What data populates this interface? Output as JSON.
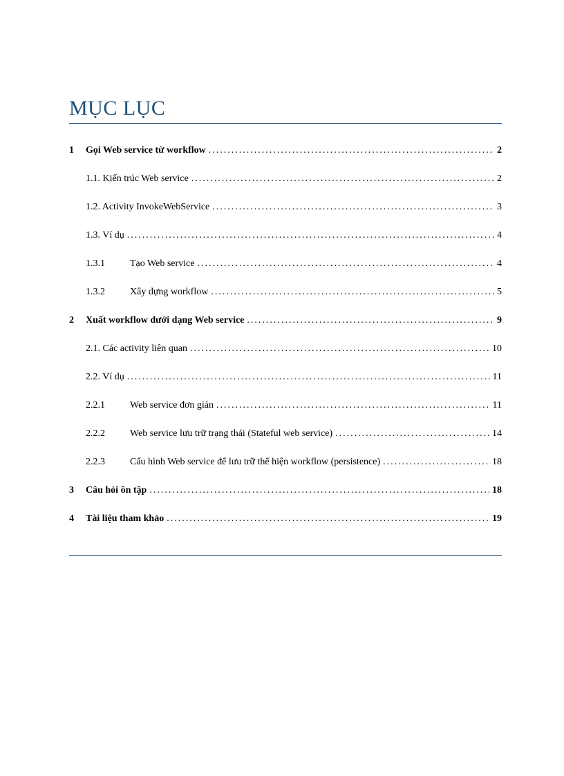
{
  "title": "MỤC LỤC",
  "entries": [
    {
      "level": 1,
      "num": "1",
      "label": "Gọi Web service từ workflow",
      "page": "2"
    },
    {
      "level": 2,
      "num": "",
      "label": "1.1. Kiến trúc Web service",
      "page": "2"
    },
    {
      "level": 2,
      "num": "",
      "label": "1.2. Activity InvokeWebService",
      "page": "3"
    },
    {
      "level": 2,
      "num": "",
      "label": "1.3. Ví dụ",
      "page": "4"
    },
    {
      "level": 3,
      "num": "1.3.1",
      "label": "Tạo Web service",
      "page": "4"
    },
    {
      "level": 3,
      "num": "1.3.2",
      "label": "Xây dựng workflow",
      "page": "5"
    },
    {
      "level": 1,
      "num": "2",
      "label": "Xuất workflow dưới dạng Web service",
      "page": "9"
    },
    {
      "level": 2,
      "num": "",
      "label": "2.1. Các activity liên quan",
      "page": "10"
    },
    {
      "level": 2,
      "num": "",
      "label": "2.2. Ví dụ",
      "page": "11"
    },
    {
      "level": 3,
      "num": "2.2.1",
      "label": "Web service đơn giản",
      "page": "11"
    },
    {
      "level": 3,
      "num": "2.2.2",
      "label": "Web service lưu trữ trạng thái (Stateful web service)",
      "page": "14"
    },
    {
      "level": 3,
      "num": "2.2.3",
      "label": "Cấu hình Web service để lưu trữ thể hiện workflow (persistence)",
      "page": "18"
    },
    {
      "level": 1,
      "num": "3",
      "label": "Câu hỏi ôn tập",
      "page": "18"
    },
    {
      "level": 1,
      "num": "4",
      "label": "Tài liệu tham khảo",
      "page": "19"
    }
  ]
}
